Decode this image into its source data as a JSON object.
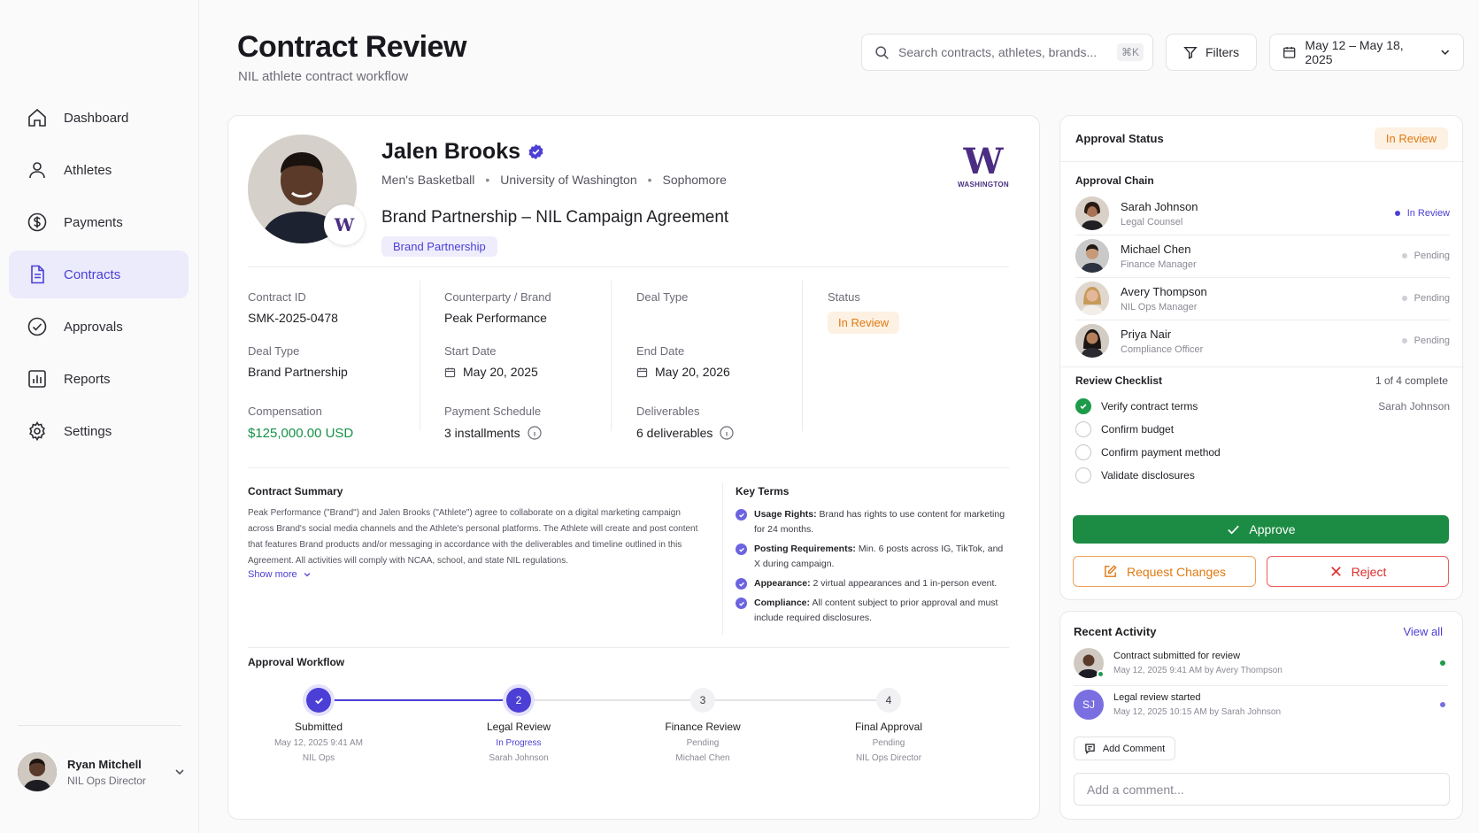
{
  "header": {
    "title": "Contract Review",
    "subtitle": "NIL athlete contract workflow",
    "search_placeholder": "Search contracts, athletes, brands...",
    "search_shortcut": "⌘K",
    "filters_label": "Filters",
    "date_range": "May 12 – May 18, 2025"
  },
  "sidebar": {
    "items": [
      {
        "label": "Dashboard",
        "icon": "home-icon"
      },
      {
        "label": "Athletes",
        "icon": "user-icon"
      },
      {
        "label": "Payments",
        "icon": "dollar-icon"
      },
      {
        "label": "Contracts",
        "icon": "document-icon",
        "active": true
      },
      {
        "label": "Approvals",
        "icon": "check-circle-icon"
      },
      {
        "label": "Reports",
        "icon": "bar-chart-icon"
      },
      {
        "label": "Settings",
        "icon": "gear-icon"
      }
    ],
    "user": {
      "name": "Ryan Mitchell",
      "role": "NIL Ops Director"
    }
  },
  "athlete": {
    "name": "Jalen Brooks",
    "sport": "Men's Basketball",
    "school": "University of Washington",
    "year": "Sophomore",
    "agreement": "Brand Partnership – NIL Campaign Agreement",
    "tag": "Brand Partnership",
    "badge_letter": "W",
    "school_logo_letter": "W",
    "school_logo_text": "WASHINGTON"
  },
  "contract": {
    "id_label": "Contract ID",
    "id": "SMK-2025-0478",
    "counterparty_label": "Counterparty / Brand",
    "counterparty": "Peak Performance",
    "deal_type_label": "Deal Type",
    "status_label": "Status",
    "status": "In Review",
    "deal_type2_label": "Deal Type",
    "deal_type": "Brand Partnership",
    "start_label": "Start Date",
    "start": "May 20, 2025",
    "end_label": "End Date",
    "end": "May 20, 2026",
    "comp_label": "Compensation",
    "comp": "$125,000.00 USD",
    "schedule_label": "Payment Schedule",
    "schedule": "3 installments",
    "deliverables_label": "Deliverables",
    "deliverables": "6 deliverables"
  },
  "summary": {
    "title": "Contract Summary",
    "text": "Peak Performance (\"Brand\") and Jalen Brooks (\"Athlete\") agree to collaborate on a digital marketing campaign across Brand's social media channels and the Athlete's personal platforms. The Athlete will create and post content that features Brand products and/or messaging in accordance with the deliverables and timeline outlined in this Agreement. All activities will comply with NCAA, school, and state NIL regulations.",
    "show_more": "Show more"
  },
  "key_terms": {
    "title": "Key Terms",
    "items": [
      {
        "label": "Usage Rights:",
        "text": "Brand has rights to use content for marketing for 24 months."
      },
      {
        "label": "Posting Requirements:",
        "text": "Min. 6 posts across IG, TikTok, and X during campaign."
      },
      {
        "label": "Appearance:",
        "text": "2 virtual appearances and 1 in-person event."
      },
      {
        "label": "Compliance:",
        "text": "All content subject to prior approval and must include required disclosures."
      }
    ]
  },
  "workflow": {
    "title": "Approval Workflow",
    "steps": [
      {
        "num": "",
        "title": "Submitted",
        "status": "May 12, 2025 9:41 AM",
        "who": "NIL Ops"
      },
      {
        "num": "2",
        "title": "Legal Review",
        "status": "In Progress",
        "who": "Sarah Johnson"
      },
      {
        "num": "3",
        "title": "Finance Review",
        "status": "Pending",
        "who": "Michael Chen"
      },
      {
        "num": "4",
        "title": "Final Approval",
        "status": "Pending",
        "who": "NIL Ops Director"
      }
    ]
  },
  "approval": {
    "title": "Approval Status",
    "status": "In Review",
    "chain_title": "Approval Chain",
    "chain": [
      {
        "name": "Sarah Johnson",
        "role": "Legal Counsel",
        "status": "In Review"
      },
      {
        "name": "Michael Chen",
        "role": "Finance Manager",
        "status": "Pending"
      },
      {
        "name": "Avery Thompson",
        "role": "NIL Ops Manager",
        "status": "Pending"
      },
      {
        "name": "Priya Nair",
        "role": "Compliance Officer",
        "status": "Pending"
      }
    ],
    "checklist_title": "Review Checklist",
    "checklist_progress": "1 of 4 complete",
    "checklist": [
      {
        "label": "Verify contract terms",
        "who": "Sarah Johnson",
        "done": true
      },
      {
        "label": "Confirm budget",
        "who": "",
        "done": false
      },
      {
        "label": "Confirm payment method",
        "who": "",
        "done": false
      },
      {
        "label": "Validate disclosures",
        "who": "",
        "done": false
      }
    ],
    "approve_label": "Approve",
    "request_label": "Request Changes",
    "reject_label": "Reject"
  },
  "activity": {
    "title": "Recent Activity",
    "view_all": "View all",
    "items": [
      {
        "text": "Contract submitted for review",
        "meta": "May 12, 2025 9:41 AM by Avery Thompson",
        "initials": ""
      },
      {
        "text": "Legal review started",
        "meta": "May 12, 2025 10:15 AM by Sarah Johnson",
        "initials": "SJ"
      }
    ],
    "add_comment": "Add Comment",
    "comment_placeholder": "Add a comment..."
  },
  "colors": {
    "accent": "#4b3fd6",
    "approve": "#1c8b43",
    "warning": "#e07a12",
    "danger": "#dc2b2b",
    "husky_purple": "#4b2e83"
  }
}
